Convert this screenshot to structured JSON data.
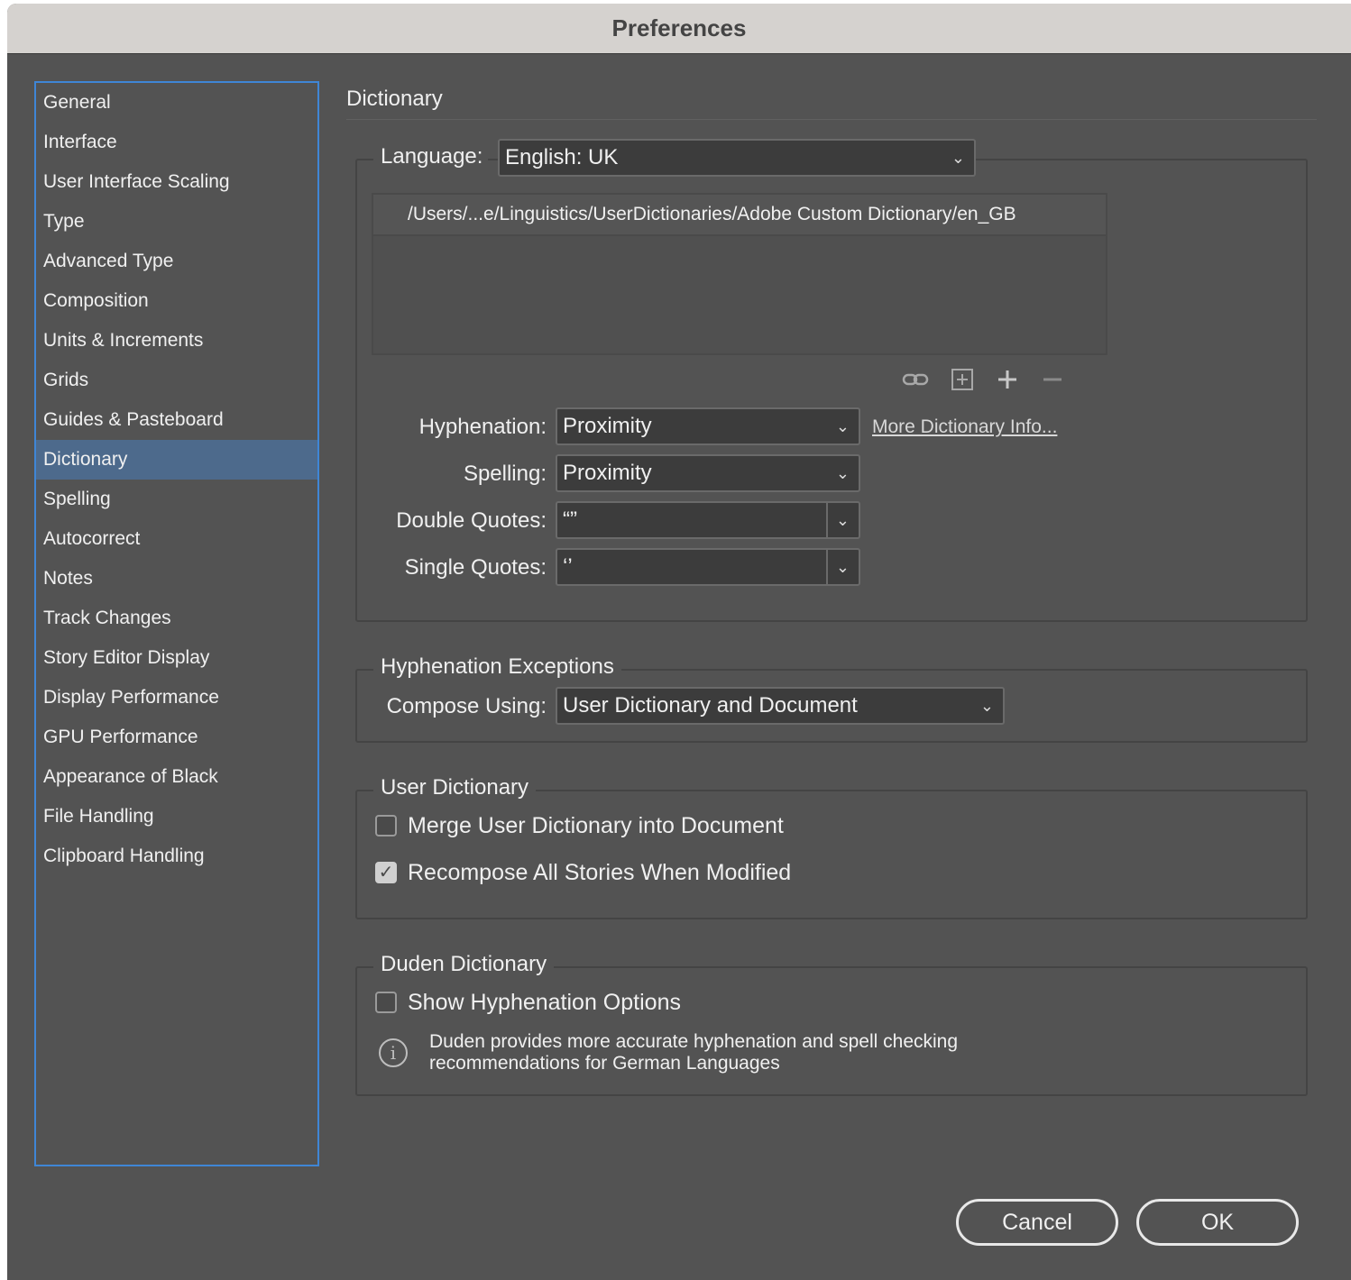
{
  "window": {
    "title": "Preferences"
  },
  "sidebar": {
    "items": [
      {
        "label": "General"
      },
      {
        "label": "Interface"
      },
      {
        "label": "User Interface Scaling"
      },
      {
        "label": "Type"
      },
      {
        "label": "Advanced Type"
      },
      {
        "label": "Composition"
      },
      {
        "label": "Units & Increments"
      },
      {
        "label": "Grids"
      },
      {
        "label": "Guides & Pasteboard"
      },
      {
        "label": "Dictionary",
        "selected": true
      },
      {
        "label": "Spelling"
      },
      {
        "label": "Autocorrect"
      },
      {
        "label": "Notes"
      },
      {
        "label": "Track Changes"
      },
      {
        "label": "Story Editor Display"
      },
      {
        "label": "Display Performance"
      },
      {
        "label": "GPU Performance"
      },
      {
        "label": "Appearance of Black"
      },
      {
        "label": "File Handling"
      },
      {
        "label": "Clipboard Handling"
      }
    ]
  },
  "panel": {
    "title": "Dictionary",
    "language": {
      "label": "Language:",
      "value": "English: UK"
    },
    "dictionary_path": "/Users/...e/Linguistics/UserDictionaries/Adobe Custom Dictionary/en_GB",
    "toolbar_icons": [
      "link-icon",
      "add-box-icon",
      "plus-icon",
      "minus-icon"
    ],
    "hyphenation": {
      "label": "Hyphenation:",
      "value": "Proximity"
    },
    "more_info_link": "More Dictionary Info...",
    "spelling": {
      "label": "Spelling:",
      "value": "Proximity"
    },
    "double_quotes": {
      "label": "Double Quotes:",
      "value": "“”"
    },
    "single_quotes": {
      "label": "Single Quotes:",
      "value": "‘’"
    },
    "hyphenation_exceptions": {
      "legend": "Hyphenation Exceptions",
      "compose_label": "Compose Using:",
      "compose_value": "User Dictionary and Document"
    },
    "user_dictionary": {
      "legend": "User Dictionary",
      "merge_label": "Merge User Dictionary into Document",
      "merge_checked": false,
      "recompose_label": "Recompose All Stories When Modified",
      "recompose_checked": true
    },
    "duden": {
      "legend": "Duden Dictionary",
      "show_label": "Show Hyphenation Options",
      "show_checked": false,
      "info_line1": "Duden provides more accurate hyphenation and spell checking",
      "info_line2": "recommendations for German Languages"
    }
  },
  "buttons": {
    "cancel": "Cancel",
    "ok": "OK"
  },
  "colors": {
    "selection": "#4d6a8c",
    "focus_ring": "#3f86d6",
    "panel_bg": "#535353"
  }
}
